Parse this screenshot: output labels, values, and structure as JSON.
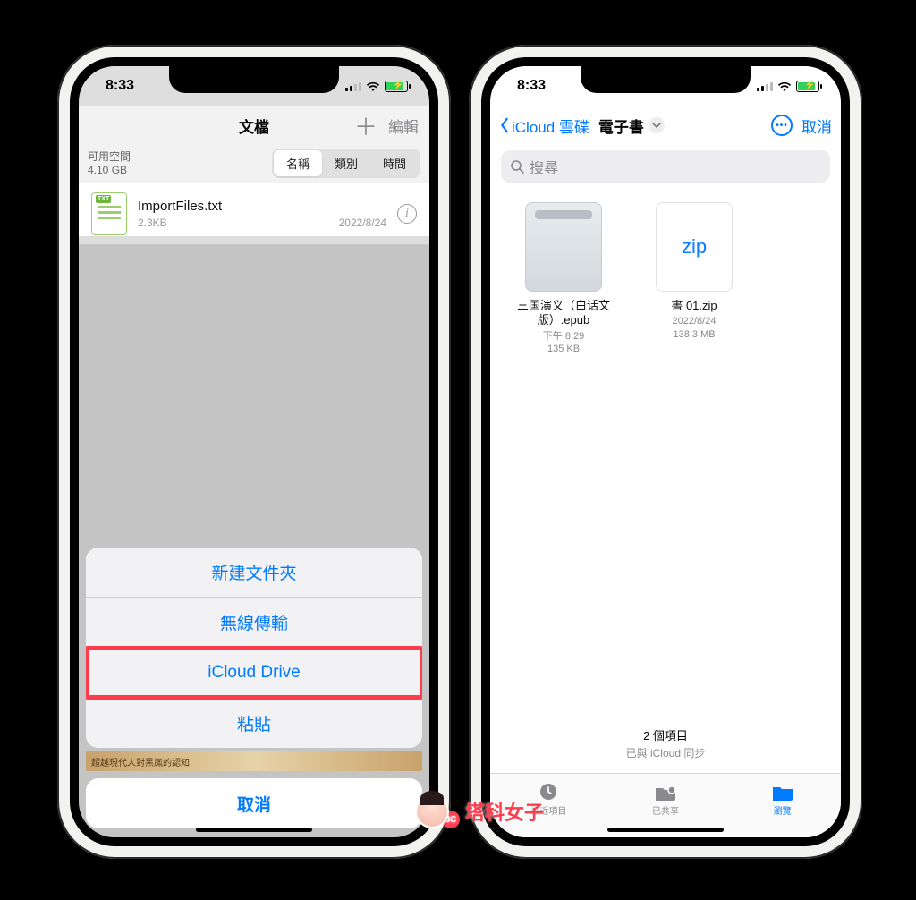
{
  "status": {
    "time": "8:33"
  },
  "left": {
    "nav": {
      "title": "文檔",
      "edit": "編輯"
    },
    "storage": {
      "label": "可用空間",
      "value": "4.10 GB"
    },
    "segments": {
      "name": "名稱",
      "kind": "類別",
      "time": "時間"
    },
    "file": {
      "name": "ImportFiles.txt",
      "size": "2.3KB",
      "date": "2022/8/24",
      "badge": "TXT"
    },
    "sheet": {
      "new_folder": "新建文件夾",
      "wireless": "無線傳輸",
      "icloud": "iCloud Drive",
      "paste": "粘貼",
      "cancel": "取消"
    },
    "ad": "超越現代人對黑鳳的認知"
  },
  "right": {
    "nav": {
      "back": "iCloud 雲碟",
      "title": "電子書",
      "cancel": "取消"
    },
    "search_placeholder": "搜尋",
    "items": [
      {
        "name": "三国演义（白话文版）.epub",
        "time": "下午 8:29",
        "size": "135 KB"
      },
      {
        "name": "書 01.zip",
        "time": "2022/8/24",
        "size": "138.3 MB",
        "ziplabel": "zip"
      }
    ],
    "footer": {
      "count": "2 個項目",
      "sync": "已與 iCloud 同步"
    },
    "tabs": {
      "recent": "最近項目",
      "shared": "已共享",
      "browse": "瀏覽"
    }
  },
  "watermark": {
    "text": "塔科女子",
    "badge": "3C"
  }
}
